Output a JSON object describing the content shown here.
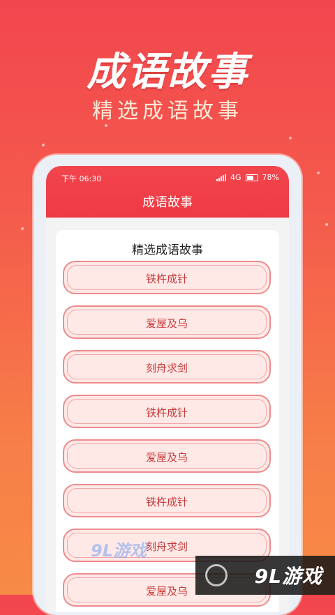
{
  "promo": {
    "title": "成语故事",
    "subtitle": "精选成语故事"
  },
  "status_bar": {
    "time": "下午 06:30",
    "network": "4G",
    "battery": "78%"
  },
  "app_bar": {
    "title": "成语故事"
  },
  "list": {
    "heading": "精选成语故事",
    "items": [
      {
        "label": "铁杵成针"
      },
      {
        "label": "爱屋及乌"
      },
      {
        "label": "刻舟求剑"
      },
      {
        "label": "铁杵成针"
      },
      {
        "label": "爱屋及乌"
      },
      {
        "label": "铁杵成针"
      },
      {
        "label": "刻舟求剑"
      },
      {
        "label": "爱屋及乌"
      }
    ]
  },
  "watermark": {
    "left_text": "9L游戏",
    "right_text": "9L游戏"
  },
  "colors": {
    "accent": "#f2454d",
    "button_fill": "#ffe9e7",
    "button_border": "#ef8a8c",
    "button_text": "#c73a3a"
  }
}
